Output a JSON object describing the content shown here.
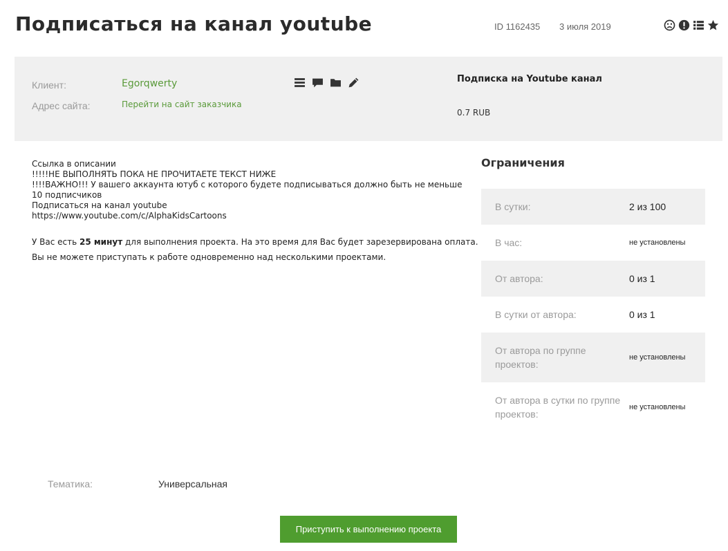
{
  "header": {
    "title": "Подписаться на канал youtube",
    "id_text": "ID  1162435",
    "date": "3 июля 2019",
    "icons": [
      "sad-face-icon",
      "exclamation-icon",
      "list-icon",
      "star-icon"
    ]
  },
  "client_panel": {
    "client_label": "Клиент:",
    "client_name": "Egorqwerty",
    "site_label": "Адрес сайта:",
    "site_link": "Перейти на сайт заказчика",
    "icons": [
      "menu-icon",
      "comment-icon",
      "folder-icon",
      "pencil-icon"
    ],
    "task_type": "Подписка на Youtube канал",
    "price": "0.7 RUB"
  },
  "description": {
    "lines": [
      "Ссылка в описании",
      "!!!!!НЕ ВЫПОЛНЯТЬ ПОКА НЕ ПРОЧИТАЕТЕ ТЕКСТ НИЖЕ",
      "!!!!ВАЖНО!!! У вашего аккаунта ютуб с которого будете подписываться должно быть не меньше 10 подписчиков",
      "Подписаться на канал youtube",
      "https://www.youtube.com/c/AlphaKidsCartoons"
    ]
  },
  "notice": {
    "time_prefix": "У Вас есть",
    "time_value": "25 минут",
    "time_suffix": "для выполнения проекта. На это время для Вас будет зарезервирована оплата.",
    "parallel": "Вы не можете приступать к работе одновременно над несколькими проектами."
  },
  "limits": {
    "title": "Ограничения",
    "rows": [
      {
        "label": "В сутки:",
        "value": "2 из 100"
      },
      {
        "label": "В час:",
        "value": "не установлены"
      },
      {
        "label": "От автора:",
        "value": "0 из 1"
      },
      {
        "label": "В сутки от автора:",
        "value": "0 из 1"
      },
      {
        "label": "От автора по группе проектов:",
        "value": "не установлены"
      },
      {
        "label": "От автора в сутки по группе проектов:",
        "value": "не установлены"
      }
    ]
  },
  "topic": {
    "label": "Тематика:",
    "value": "Универсальная"
  },
  "action": {
    "start_label": "Приступить к выполнению проекта"
  },
  "colors": {
    "accent_green": "#4f9d2f",
    "link_green": "#5a9a3a",
    "panel_bg": "#f0f0f0"
  }
}
